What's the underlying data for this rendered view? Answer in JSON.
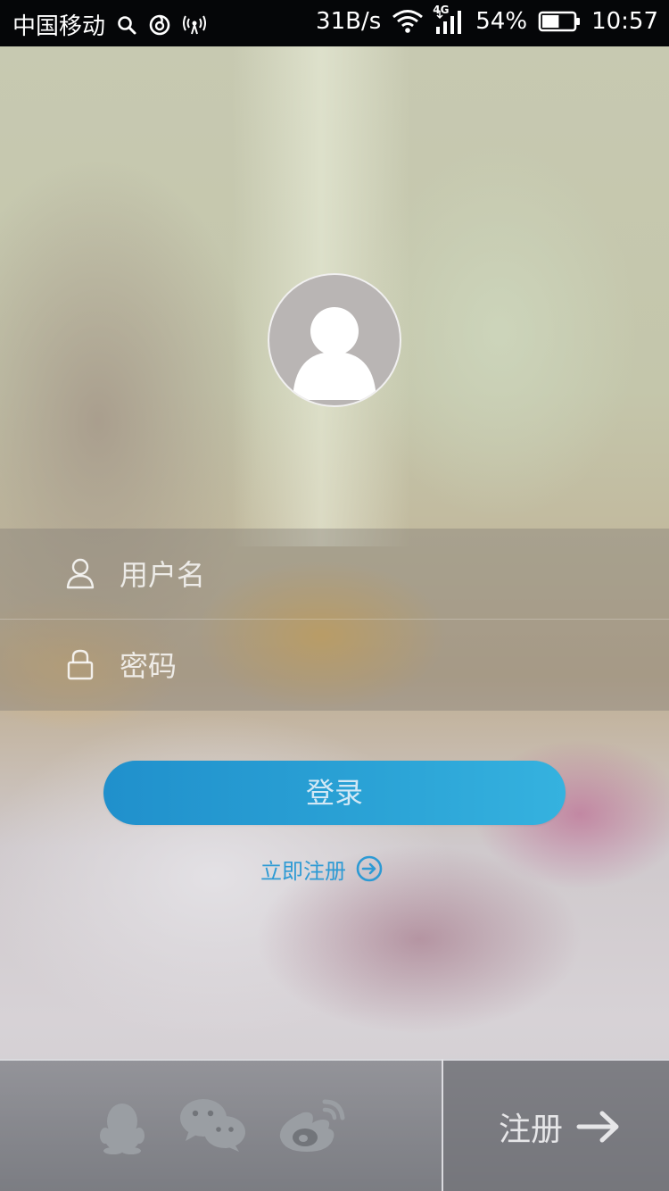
{
  "status_bar": {
    "carrier": "中国移动",
    "net_speed": "31B/s",
    "network_type": "4G",
    "battery": "54%",
    "battery_level": 0.54,
    "time": "10:57",
    "icons": [
      "search-icon",
      "netease-music-icon",
      "hotspot-icon",
      "wifi-icon",
      "signal-icon",
      "battery-icon"
    ]
  },
  "login": {
    "username_placeholder": "用户名",
    "password_placeholder": "密码",
    "login_button": "登录",
    "register_now": "立即注册"
  },
  "bottom_bar": {
    "social_icons": [
      "qq-icon",
      "wechat-icon",
      "weibo-icon"
    ],
    "register_label": "注册"
  },
  "colors": {
    "accent": "#2ba3d6",
    "link": "#2d9ad4",
    "status_bar_bg": "#050608"
  }
}
